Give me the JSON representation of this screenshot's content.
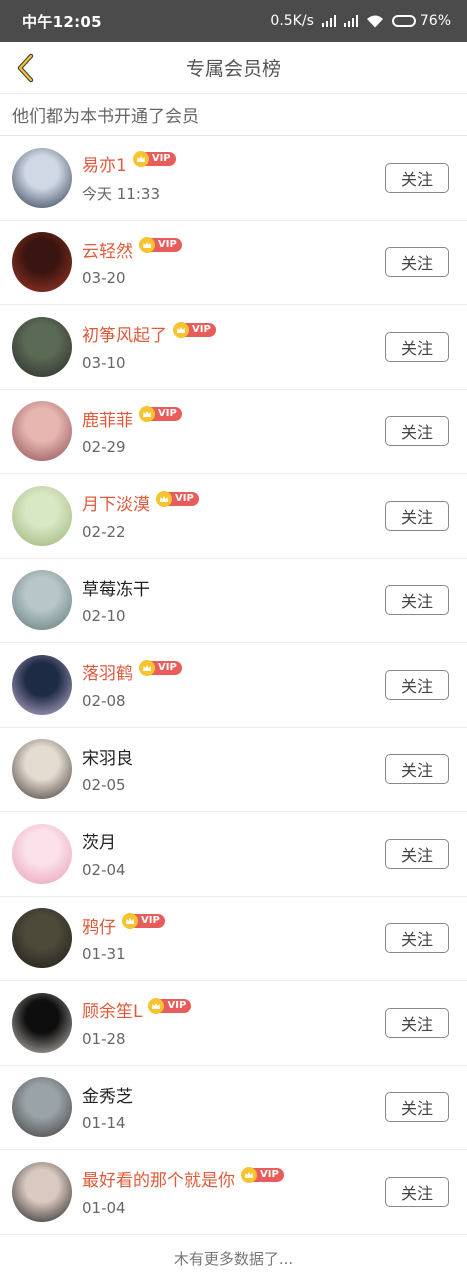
{
  "status_bar": {
    "time": "中午12:05",
    "net_speed": "0.5K/s",
    "battery": "76%",
    "battery_level": 0.76
  },
  "header": {
    "title": "专属会员榜"
  },
  "subtitle": "他们都为本书开通了会员",
  "vip_badge_text": "VIP",
  "follow_label": "关注",
  "members": [
    {
      "name": "易亦1",
      "date": "今天 11:33",
      "vip": true,
      "avatar_colors": [
        "#cfd8e4",
        "#27364a"
      ]
    },
    {
      "name": "云轻然",
      "date": "03-20",
      "vip": true,
      "avatar_colors": [
        "#3a1410",
        "#a33a2a"
      ]
    },
    {
      "name": "初筝风起了",
      "date": "03-10",
      "vip": true,
      "avatar_colors": [
        "#5b6a55",
        "#2a2a2a"
      ]
    },
    {
      "name": "鹿菲菲",
      "date": "02-29",
      "vip": true,
      "avatar_colors": [
        "#e7b6b0",
        "#8a4c50"
      ]
    },
    {
      "name": "月下淡漠",
      "date": "02-22",
      "vip": true,
      "avatar_colors": [
        "#d8e7c4",
        "#9ab276"
      ]
    },
    {
      "name": "草莓冻干",
      "date": "02-10",
      "vip": false,
      "avatar_colors": [
        "#b9c6c9",
        "#5c7777"
      ]
    },
    {
      "name": "落羽鹤",
      "date": "02-08",
      "vip": true,
      "avatar_colors": [
        "#1e2b45",
        "#c7b8d8"
      ]
    },
    {
      "name": "宋羽良",
      "date": "02-05",
      "vip": false,
      "avatar_colors": [
        "#e5dcd1",
        "#3a3230"
      ]
    },
    {
      "name": "茨月",
      "date": "02-04",
      "vip": false,
      "avatar_colors": [
        "#fbe2ea",
        "#e79bb5"
      ]
    },
    {
      "name": "鸦仔",
      "date": "01-31",
      "vip": true,
      "avatar_colors": [
        "#4e4a3a",
        "#1c1c1a"
      ]
    },
    {
      "name": "顾余笙L",
      "date": "01-28",
      "vip": true,
      "avatar_colors": [
        "#0e0e0e",
        "#c9c4be"
      ]
    },
    {
      "name": "金秀芝",
      "date": "01-14",
      "vip": false,
      "avatar_colors": [
        "#9aa4a8",
        "#3f3a38"
      ]
    },
    {
      "name": "最好看的那个就是你",
      "date": "01-04",
      "vip": true,
      "avatar_colors": [
        "#d9c9c0",
        "#1a1a1a"
      ]
    }
  ],
  "footer_text": "木有更多数据了..."
}
